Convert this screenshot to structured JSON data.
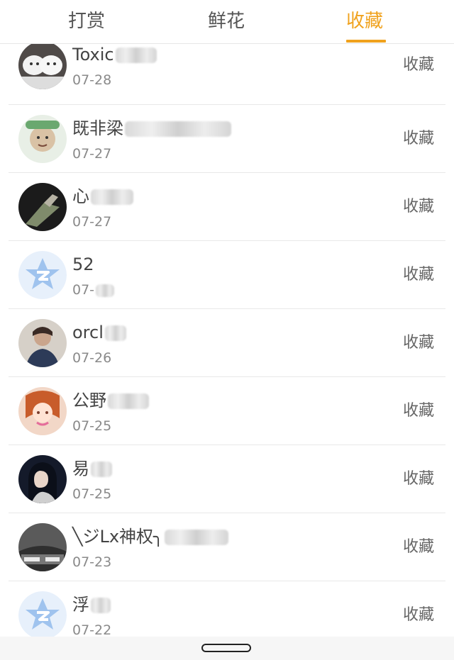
{
  "tabs": [
    "打赏",
    "鲜花",
    "收藏"
  ],
  "active_tab": "收藏",
  "items": [
    {
      "name": "Toxic",
      "date": "07-28",
      "status": "收藏",
      "avatar": "dog-photo"
    },
    {
      "name": "既非梁",
      "date": "07-27",
      "status": "收藏",
      "avatar": "person-photo"
    },
    {
      "name": "心",
      "date": "07-27",
      "status": "收藏",
      "avatar": "hand-photo"
    },
    {
      "name": "52",
      "date": "07-",
      "status": "收藏",
      "avatar": "default-qq-icon"
    },
    {
      "name": "orcl",
      "date": "07-26",
      "status": "收藏",
      "avatar": "man-photo"
    },
    {
      "name": "公野",
      "date": "07-25",
      "status": "收藏",
      "avatar": "anime-girl"
    },
    {
      "name": "易",
      "date": "07-25",
      "status": "收藏",
      "avatar": "woman-photo"
    },
    {
      "name": "╲ジLx神权╮",
      "date": "07-23",
      "status": "收藏",
      "avatar": "gray-photo"
    },
    {
      "name": "浮",
      "date": "07-22",
      "status": "收藏",
      "avatar": "default-qq-icon"
    }
  ],
  "colors": {
    "accent": "#f0a21e"
  }
}
